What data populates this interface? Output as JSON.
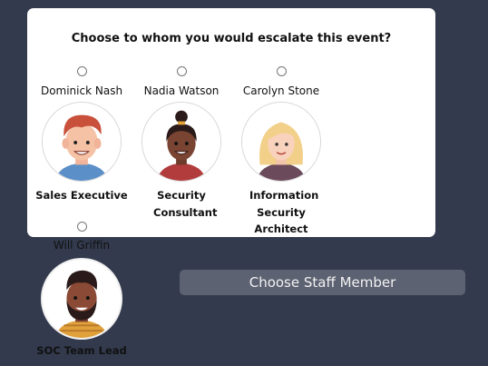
{
  "dialog": {
    "title": "Choose to whom you would escalate this event?"
  },
  "staff": [
    {
      "name": "Dominick Nash",
      "role": "Sales Executive",
      "avatar_icon": "man-red-hair-avatar-icon"
    },
    {
      "name": "Nadia Watson",
      "role": "Security Consultant",
      "avatar_icon": "woman-dark-hair-bun-avatar-icon"
    },
    {
      "name": "Carolyn Stone",
      "role": "Information Security Architect",
      "avatar_icon": "woman-blonde-avatar-icon"
    },
    {
      "name": "Will Griffin",
      "role": "SOC Team Lead",
      "avatar_icon": "man-beard-avatar-icon"
    }
  ],
  "choose_button": {
    "label": "Choose Staff Member"
  },
  "colors": {
    "background": "#333a4d",
    "card": "#ffffff",
    "button": "#5d6272"
  }
}
